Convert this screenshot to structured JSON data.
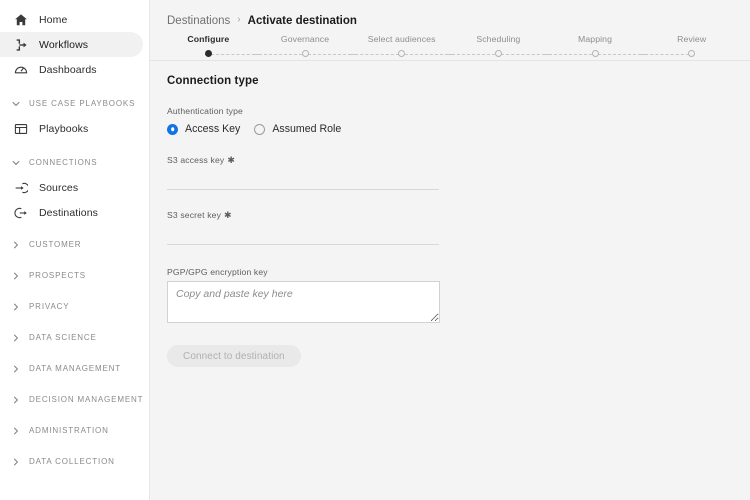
{
  "sidebar": {
    "nav": [
      {
        "label": "Home",
        "icon": "home-icon",
        "active": false
      },
      {
        "label": "Workflows",
        "icon": "workflows-icon",
        "active": true
      },
      {
        "label": "Dashboards",
        "icon": "dashboards-icon",
        "active": false
      }
    ],
    "playbooks_section": {
      "label": "Use case playbooks",
      "icon": "chevron-down-icon",
      "expanded": true
    },
    "playbooks_item": {
      "label": "Playbooks",
      "icon": "playbooks-grid-icon"
    },
    "connections_section": {
      "label": "Connections",
      "icon": "chevron-down-icon",
      "expanded": true
    },
    "connections_items": [
      {
        "label": "Sources",
        "icon": "arrow-into-circle-icon"
      },
      {
        "label": "Destinations",
        "icon": "arrow-out-of-circle-icon"
      }
    ],
    "collapsed_sections": [
      {
        "label": "Customer",
        "icon": "chevron-right-icon"
      },
      {
        "label": "Prospects",
        "icon": "chevron-right-icon"
      },
      {
        "label": "Privacy",
        "icon": "chevron-right-icon"
      },
      {
        "label": "Data science",
        "icon": "chevron-right-icon"
      },
      {
        "label": "Data management",
        "icon": "chevron-right-icon"
      },
      {
        "label": "Decision management",
        "icon": "chevron-right-icon"
      },
      {
        "label": "Administration",
        "icon": "chevron-right-icon"
      },
      {
        "label": "Data collection",
        "icon": "chevron-right-icon"
      }
    ]
  },
  "breadcrumb": {
    "parent": "Destinations",
    "separator": "›",
    "current": "Activate destination"
  },
  "stepper": {
    "steps": [
      {
        "label": "Configure",
        "state": "current"
      },
      {
        "label": "Governance",
        "state": "upcoming"
      },
      {
        "label": "Select audiences",
        "state": "upcoming"
      },
      {
        "label": "Scheduling",
        "state": "upcoming"
      },
      {
        "label": "Mapping",
        "state": "upcoming"
      },
      {
        "label": "Review",
        "state": "upcoming"
      }
    ]
  },
  "form": {
    "panel_title": "Connection type",
    "auth_label": "Authentication type",
    "auth_options": [
      {
        "label": "Access Key",
        "selected": true
      },
      {
        "label": "Assumed Role",
        "selected": false
      }
    ],
    "access_key": {
      "label": "S3 access key",
      "required_mark": "✱",
      "value": "",
      "placeholder": ""
    },
    "secret_key": {
      "label": "S3 secret key",
      "required_mark": "✱",
      "value": "",
      "placeholder": ""
    },
    "pgp_key": {
      "label": "PGP/GPG encryption key",
      "value": "",
      "placeholder": "Copy and paste key here"
    },
    "submit": {
      "label": "Connect to destination",
      "disabled": true
    }
  },
  "colors": {
    "accent": "#1473e6",
    "sidebar_bg": "#ffffff",
    "content_bg": "#f4f4f4",
    "active_nav_bg": "#f1f1f1",
    "disabled_btn_bg": "#e9e9e9",
    "step_active_dot": "#2b2b2b"
  }
}
